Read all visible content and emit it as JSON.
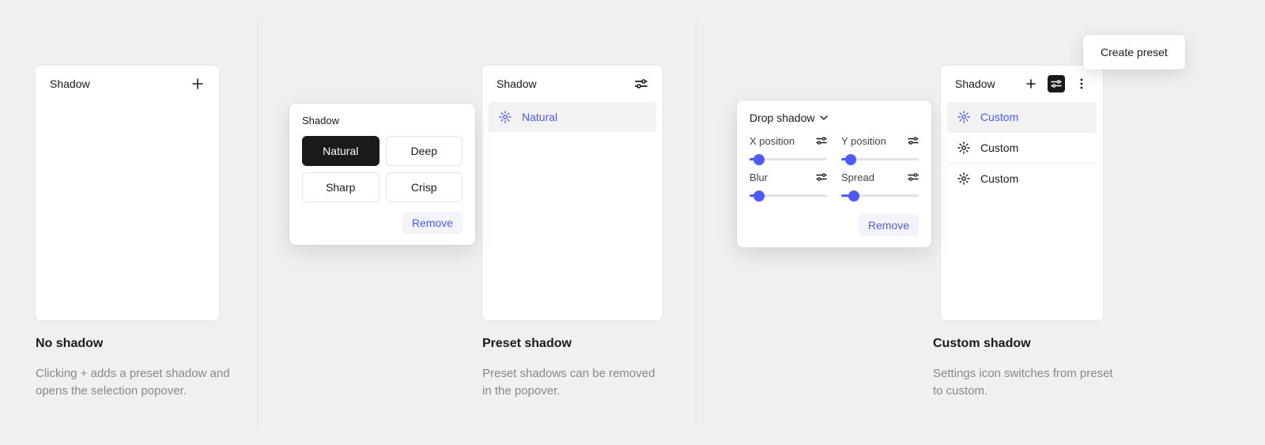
{
  "section1": {
    "panel_title": "Shadow",
    "caption_title": "No shadow",
    "caption_text": "Clicking + adds a preset shadow and opens the selection popover."
  },
  "section2": {
    "panel_title": "Shadow",
    "selected_preset": "Natural",
    "popover_title": "Shadow",
    "options": [
      "Natural",
      "Deep",
      "Sharp",
      "Crisp"
    ],
    "remove_label": "Remove",
    "caption_title": "Preset shadow",
    "caption_text": "Preset shadows can be removed in the popover."
  },
  "section3": {
    "panel_title": "Shadow",
    "preset_items": [
      "Custom",
      "Custom",
      "Custom"
    ],
    "tooltip_text": "Create preset",
    "popover_dropdown_label": "Drop shadow",
    "fields": {
      "x": {
        "label": "X position",
        "pct": 12
      },
      "y": {
        "label": "Y position",
        "pct": 12
      },
      "blur": {
        "label": "Blur",
        "pct": 12
      },
      "spread": {
        "label": "Spread",
        "pct": 16
      }
    },
    "remove_label": "Remove",
    "caption_title": "Custom shadow",
    "caption_text": "Settings icon switches from preset to custom."
  }
}
